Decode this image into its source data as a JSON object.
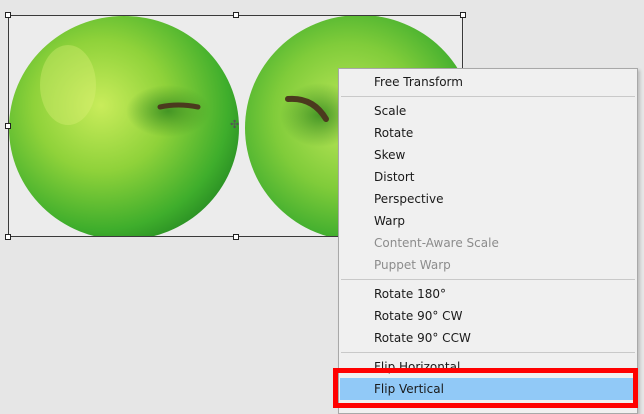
{
  "canvas": {
    "image_description_icon": "green-apples-image"
  },
  "context_menu": {
    "items": [
      {
        "label": "Free Transform",
        "enabled": true
      },
      {
        "label": "Scale",
        "enabled": true
      },
      {
        "label": "Rotate",
        "enabled": true
      },
      {
        "label": "Skew",
        "enabled": true
      },
      {
        "label": "Distort",
        "enabled": true
      },
      {
        "label": "Perspective",
        "enabled": true
      },
      {
        "label": "Warp",
        "enabled": true
      },
      {
        "label": "Content-Aware Scale",
        "enabled": false
      },
      {
        "label": "Puppet Warp",
        "enabled": false
      },
      {
        "label": "Rotate 180°",
        "enabled": true
      },
      {
        "label": "Rotate 90° CW",
        "enabled": true
      },
      {
        "label": "Rotate 90° CCW",
        "enabled": true
      },
      {
        "label": "Flip Horizontal",
        "enabled": true
      },
      {
        "label": "Flip Vertical",
        "enabled": true,
        "selected": true
      }
    ]
  },
  "colors": {
    "selection_bg": "#91c9f7",
    "highlight_border": "#ff0000",
    "disabled_text": "#8c8c8c"
  }
}
